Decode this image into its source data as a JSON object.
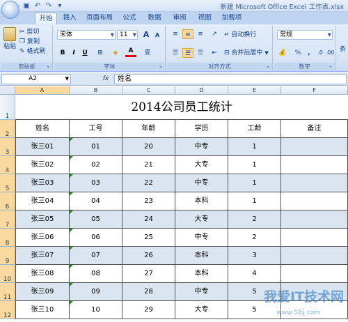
{
  "window": {
    "title": "新建 Microsoft Office Excel 工作表.xlsx"
  },
  "tabs": [
    "开始",
    "插入",
    "页面布局",
    "公式",
    "数据",
    "审阅",
    "视图",
    "加载项"
  ],
  "ribbon": {
    "clipboard": {
      "label": "剪贴板",
      "paste": "粘贴",
      "cut": "剪切",
      "copy": "复制",
      "format_painter": "格式刷"
    },
    "font": {
      "label": "字体",
      "name": "宋体",
      "size": "11",
      "bold": "B",
      "italic": "I",
      "underline": "U",
      "grow": "A",
      "shrink": "A",
      "font_color_letter": "A",
      "phonetic": "变"
    },
    "alignment": {
      "label": "对齐方式",
      "wrap": "自动换行",
      "merge": "合并后居中"
    },
    "number": {
      "label": "数字",
      "format": "常规",
      "percent": "%",
      "comma": ","
    },
    "styles_peek": "条"
  },
  "formula_bar": {
    "cell_ref": "A2",
    "fx": "fx",
    "content": "姓名"
  },
  "sheet": {
    "columns": [
      "A",
      "B",
      "C",
      "D",
      "E",
      "F"
    ],
    "row_numbers": [
      "1",
      "2",
      "3",
      "4",
      "5",
      "6",
      "7",
      "8",
      "9",
      "10",
      "11",
      "12"
    ],
    "title": "2014公司员工统计",
    "headers": [
      "姓名",
      "工号",
      "年龄",
      "学历",
      "工龄",
      "备注"
    ],
    "rows": [
      [
        "张三01",
        "01",
        "20",
        "中专",
        "1",
        ""
      ],
      [
        "张三02",
        "02",
        "21",
        "大专",
        "1",
        ""
      ],
      [
        "张三03",
        "03",
        "22",
        "中专",
        "1",
        ""
      ],
      [
        "张三04",
        "04",
        "23",
        "本科",
        "1",
        ""
      ],
      [
        "张三05",
        "05",
        "24",
        "大专",
        "2",
        ""
      ],
      [
        "张三06",
        "06",
        "25",
        "中专",
        "2",
        ""
      ],
      [
        "张三07",
        "07",
        "26",
        "本科",
        "3",
        ""
      ],
      [
        "张三08",
        "08",
        "27",
        "本科",
        "4",
        ""
      ],
      [
        "张三09",
        "09",
        "28",
        "中专",
        "5",
        ""
      ],
      [
        "张三10",
        "10",
        "29",
        "大专",
        "5",
        ""
      ]
    ]
  },
  "watermark": {
    "text": "我爱IT技术网",
    "url": "www.52ij.com"
  },
  "colors": {
    "band": "#dbe5f1",
    "selected_header": "#f9d99f",
    "ribbon": "#d8e6f7"
  }
}
